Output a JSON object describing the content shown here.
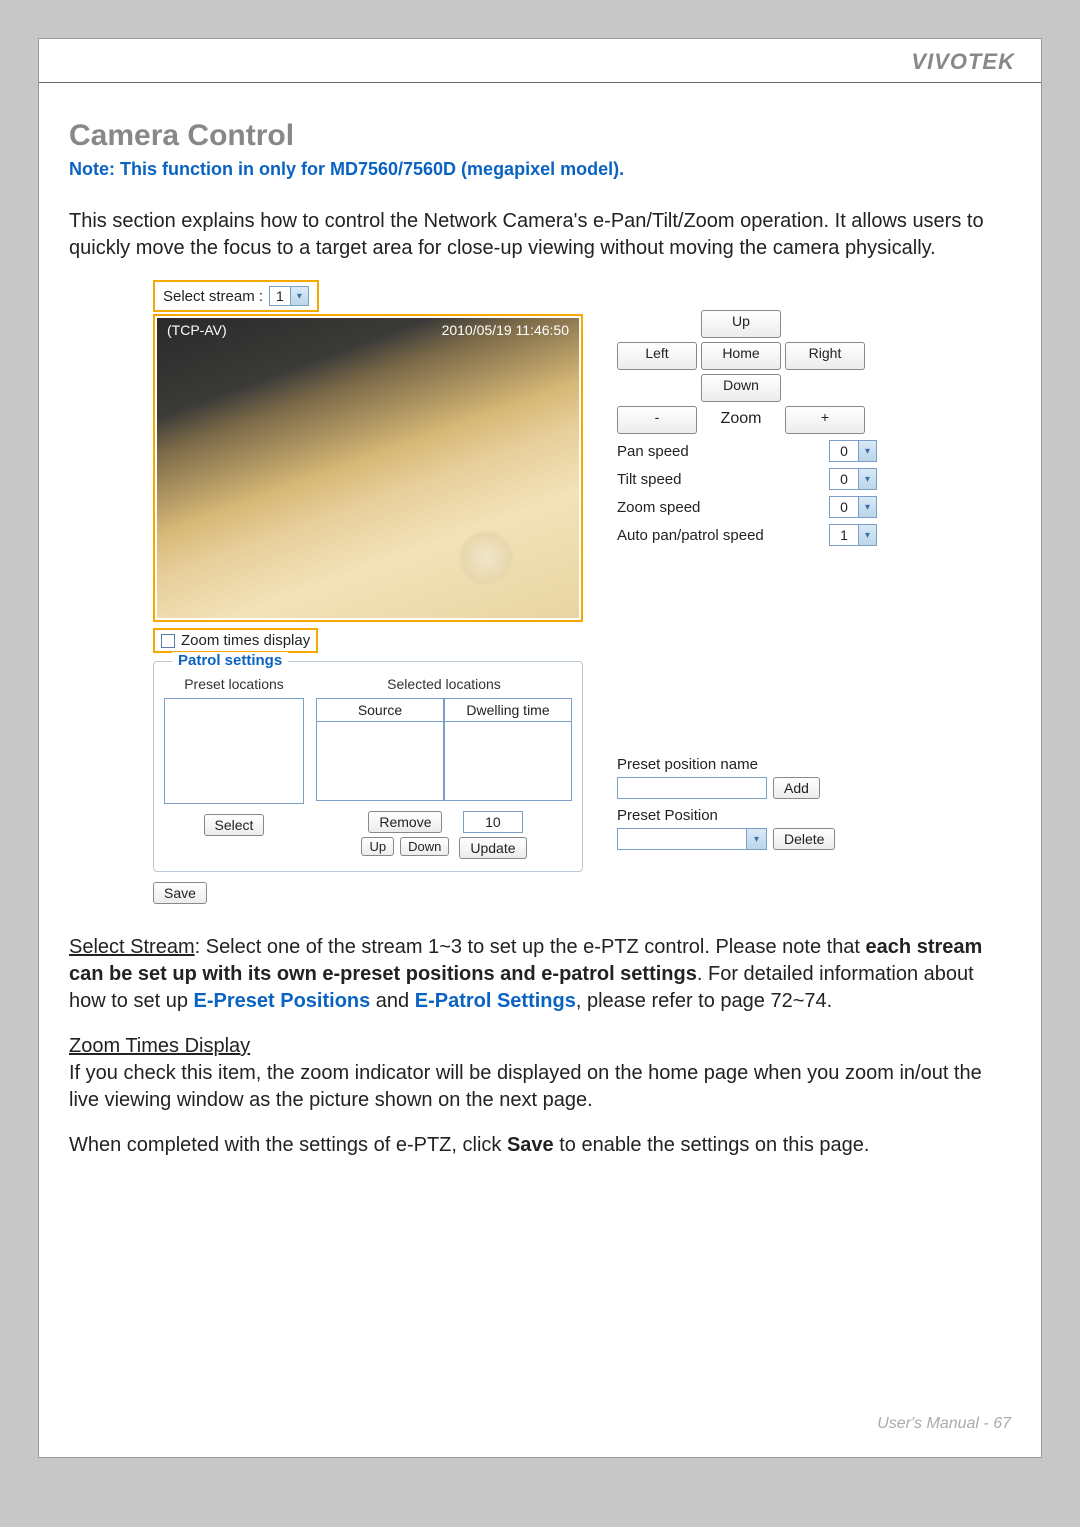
{
  "brand": "VIVOTEK",
  "title": "Camera Control",
  "note": "Note: This function in only for MD7560/7560D (megapixel model).",
  "intro": "This section explains how to control the Network Camera's e-Pan/Tilt/Zoom operation. It allows users to quickly move the focus to a target area for close-up viewing without moving the camera physically.",
  "stream": {
    "label": "Select stream :",
    "value": "1"
  },
  "video_overlay": {
    "protocol": "(TCP-AV)",
    "timestamp": "2010/05/19  11:46:50"
  },
  "zoom_times_display": "Zoom times display",
  "patrol": {
    "legend": "Patrol settings",
    "preset_locations": "Preset locations",
    "selected_locations": "Selected locations",
    "source": "Source",
    "dwelling_time": "Dwelling time",
    "dwell_value": "10",
    "buttons": {
      "select": "Select",
      "remove": "Remove",
      "up": "Up",
      "down": "Down",
      "update": "Update"
    }
  },
  "save": "Save",
  "ptz": {
    "up": "Up",
    "left": "Left",
    "home": "Home",
    "right": "Right",
    "down": "Down",
    "minus": "-",
    "zoom": "Zoom",
    "plus": "+"
  },
  "speeds": {
    "pan_label": "Pan speed",
    "pan_value": "0",
    "tilt_label": "Tilt speed",
    "tilt_value": "0",
    "zoom_label": "Zoom speed",
    "zoom_value": "0",
    "auto_label": "Auto pan/patrol speed",
    "auto_value": "1"
  },
  "preset": {
    "name_label": "Preset position name",
    "add": "Add",
    "pos_label": "Preset Position",
    "delete": "Delete"
  },
  "para1": {
    "lead": "Select Stream",
    "rest1": ": Select one of the stream 1~3 to set up the e-PTZ control. Please note that ",
    "bold": "each stream can be set up with its own e-preset positions and e-patrol settings",
    "rest2": ". For detailed information about how to set up ",
    "link1": "E-Preset Positions",
    "and": " and ",
    "link2": "E-Patrol Settings",
    "rest3": ", please refer to page 72~74."
  },
  "para2": {
    "lead": "Zoom Times Display",
    "body": "If you check this item, the zoom indicator will be displayed on the home page when you zoom in/out the live viewing window as the picture shown on the next page."
  },
  "para3": {
    "pre": "When completed with the settings of e-PTZ, click ",
    "bold": "Save",
    "post": " to enable the settings on this page."
  },
  "footer": "User's Manual - 67"
}
